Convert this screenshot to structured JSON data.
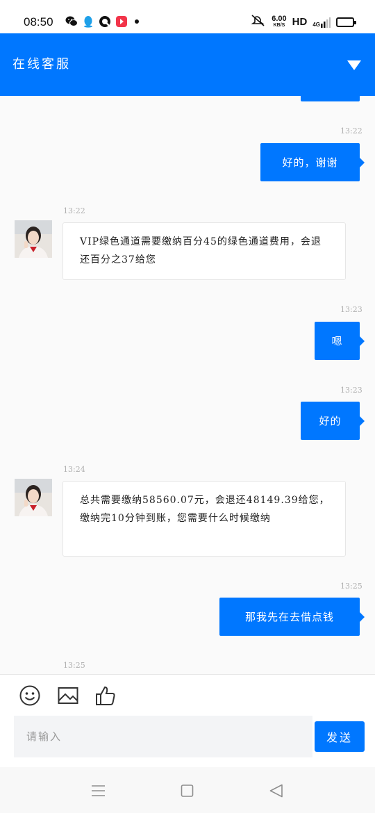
{
  "status_bar": {
    "time": "08:50",
    "speed_value": "6.00",
    "speed_unit": "KB/S",
    "hd": "HD",
    "signal": "4G",
    "battery_level": 0.6,
    "battery_color": "#f2c40c"
  },
  "header": {
    "title": "在线客服",
    "accent": "#0077ff"
  },
  "messages": [
    {
      "timestamp": "13:22",
      "direction": "out",
      "text": "好的，谢谢"
    },
    {
      "timestamp": "13:22",
      "direction": "in",
      "text": "VIP绿色通道需要缴纳百分45的绿色通道费用，会退还百分之37给您"
    },
    {
      "timestamp": "13:23",
      "direction": "out",
      "text": "嗯"
    },
    {
      "timestamp": "13:23",
      "direction": "out",
      "text": "好的"
    },
    {
      "timestamp": "13:24",
      "direction": "in",
      "text": "总共需要缴纳58560.07元，会退还48149.39给您，缴纳完10分钟到账，您需要什么时候缴纳"
    },
    {
      "timestamp": "13:25",
      "direction": "out",
      "text": "那我先在去借点钱"
    },
    {
      "timestamp": "13:25"
    }
  ],
  "composer": {
    "placeholder": "请输入",
    "send_label": "发送",
    "tools": [
      "emoji-icon",
      "image-icon",
      "thumbs-up-icon"
    ]
  },
  "nav": [
    "menu-icon",
    "home-icon",
    "back-icon"
  ]
}
